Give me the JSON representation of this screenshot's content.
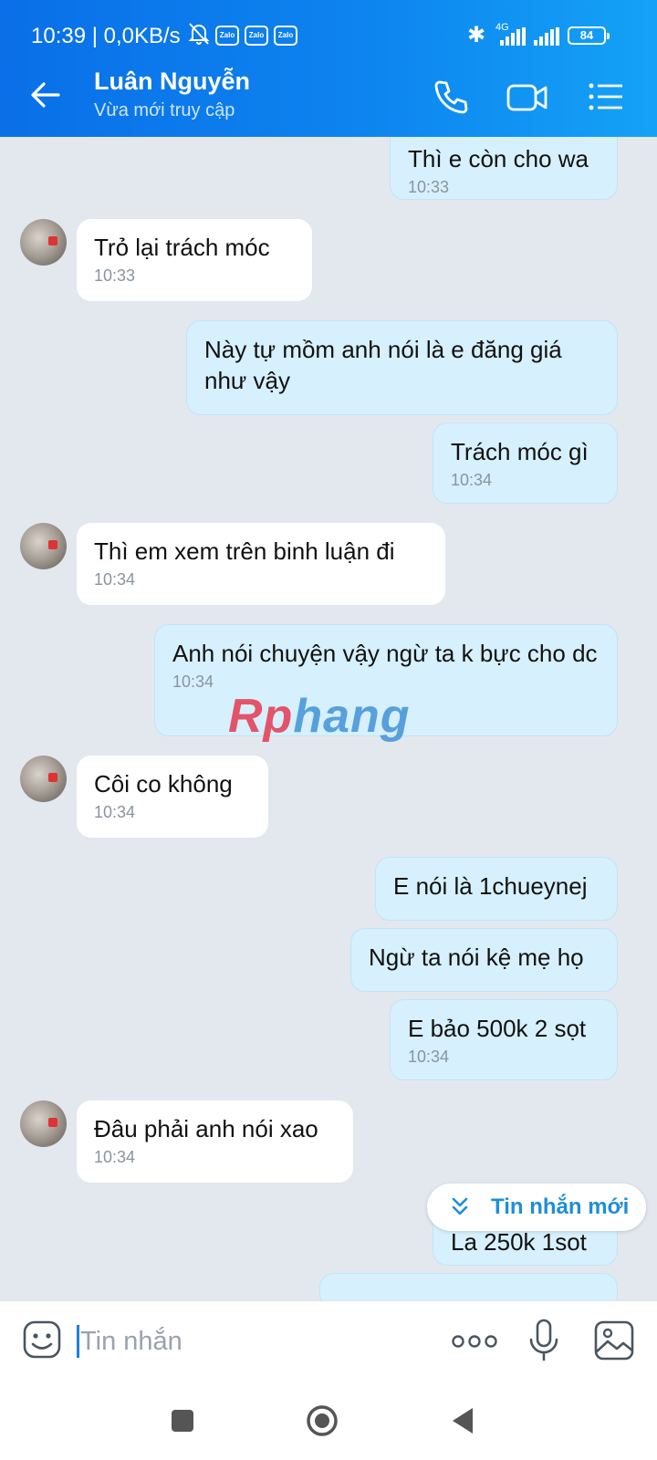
{
  "status_bar": {
    "time": "10:39 | 0,0KB/s",
    "notif_apps": [
      "Zalo",
      "Zalo",
      "Zalo"
    ],
    "network": "4G",
    "battery": "84"
  },
  "header": {
    "contact_name": "Luân Nguyễn",
    "contact_status": "Vừa mới truy cập"
  },
  "messages": [
    {
      "dir": "out",
      "text": "Thì e còn cho wa",
      "time": "10:33"
    },
    {
      "dir": "in",
      "text": "Trỏ lại trách móc",
      "time": "10:33"
    },
    {
      "dir": "out",
      "text": "Này tự mồm anh nói là e đăng giá như vậy",
      "time": ""
    },
    {
      "dir": "out",
      "text": "Trách móc gì",
      "time": "10:34"
    },
    {
      "dir": "in",
      "text": "Thì em xem trên binh luận đi",
      "time": "10:34"
    },
    {
      "dir": "out",
      "text": "Anh nói chuyện vậy ngừ ta k bực cho dc",
      "time": "10:34"
    },
    {
      "dir": "in",
      "text": "Côi co không",
      "time": "10:34"
    },
    {
      "dir": "out",
      "text": "E nói là 1chueynej",
      "time": ""
    },
    {
      "dir": "out",
      "text": "Ngừ ta nói kệ mẹ họ",
      "time": ""
    },
    {
      "dir": "out",
      "text": "E bảo 500k 2 sọt",
      "time": "10:34"
    },
    {
      "dir": "in",
      "text": "Đâu phải anh nói xao",
      "time": "10:34"
    },
    {
      "dir": "out",
      "text": "La 250k 1sot",
      "time": ""
    }
  ],
  "watermark": {
    "red": "Rp",
    "blue": "hang"
  },
  "new_messages_label": "Tin nhắn mới",
  "input": {
    "placeholder": "Tin nhắn"
  },
  "colors": {
    "header_start": "#0a6fe8",
    "header_end": "#14a2f6",
    "outgoing_bubble": "#d6f0fd",
    "incoming_bubble": "#ffffff",
    "chat_bg": "#e3e8ee",
    "accent": "#1f8ed8"
  }
}
